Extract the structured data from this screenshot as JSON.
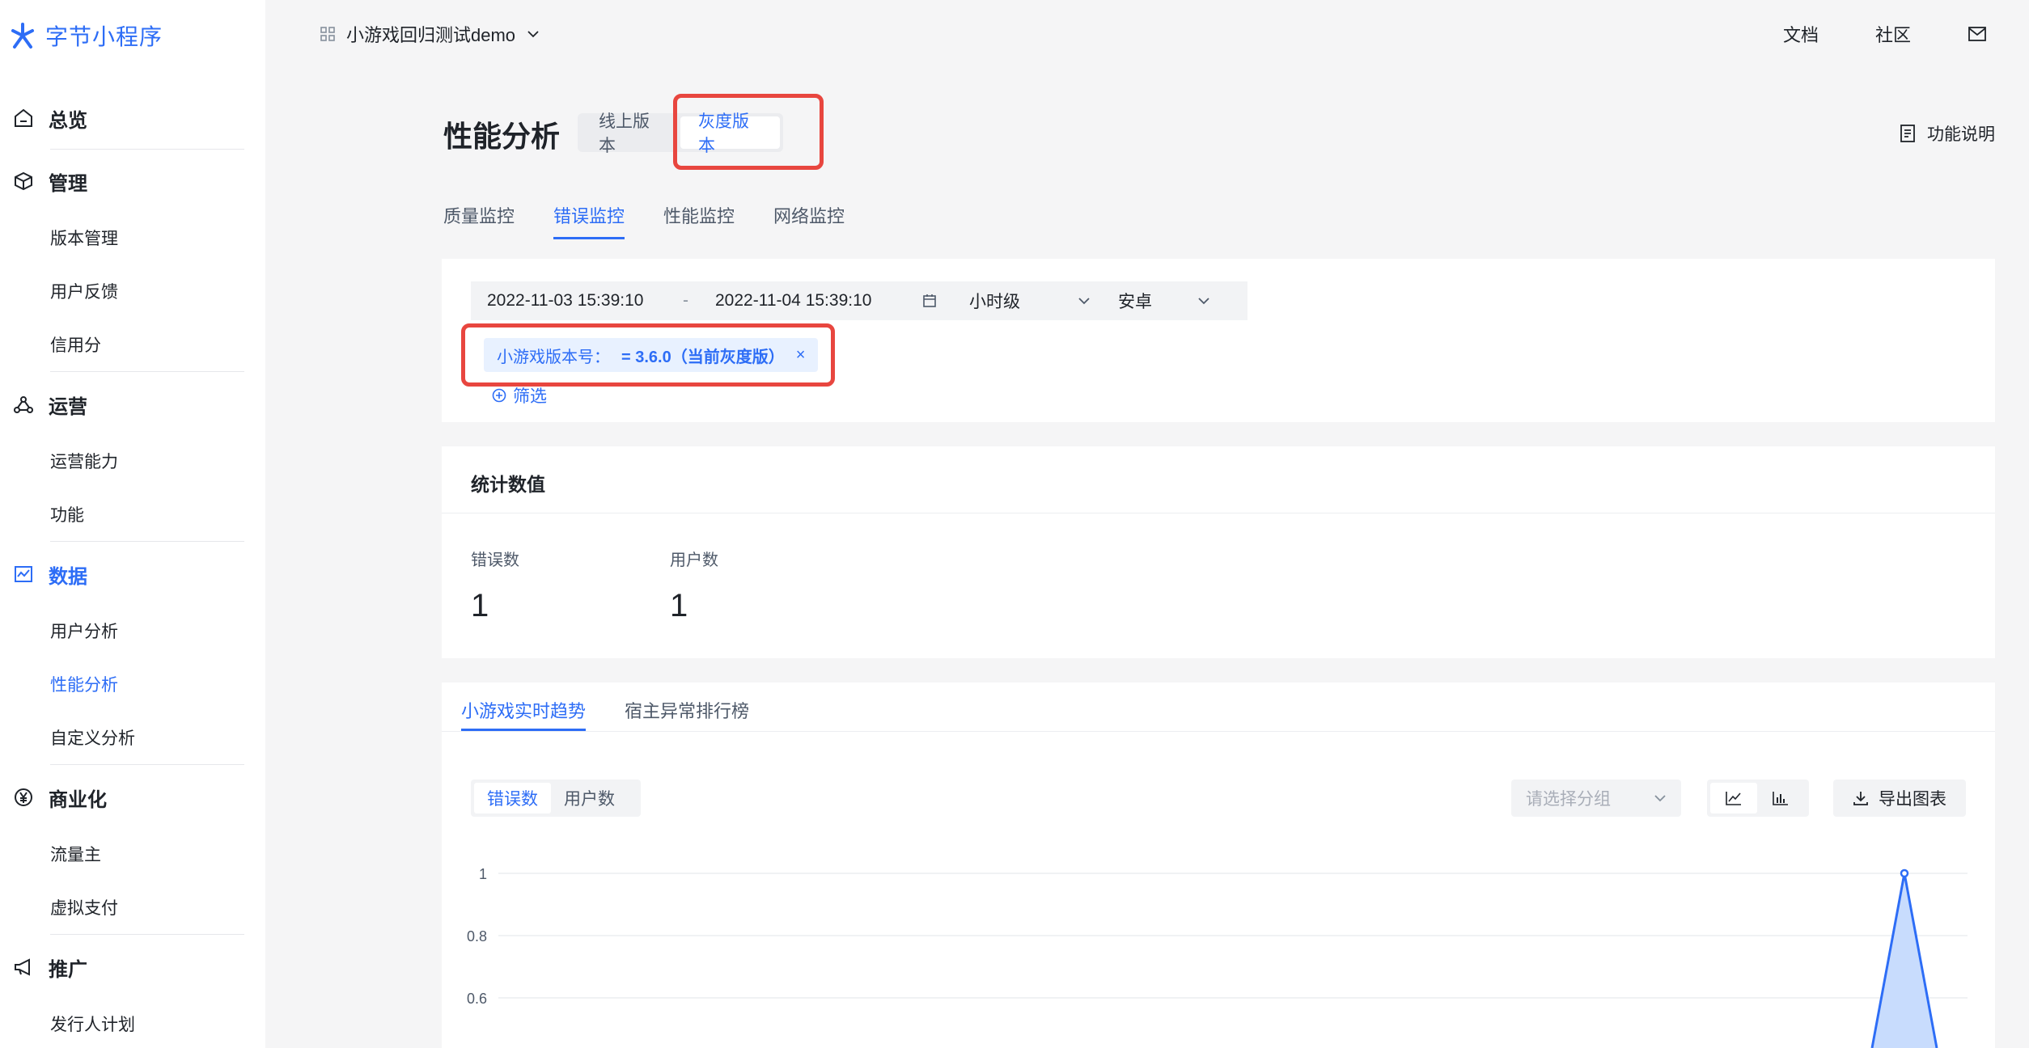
{
  "brand": {
    "name": "字节小程序",
    "color": "#2d6df6"
  },
  "sidebar": {
    "groups": [
      {
        "label": "总览",
        "icon": "home-icon",
        "items": []
      },
      {
        "label": "管理",
        "icon": "cube-icon",
        "items": [
          "版本管理",
          "用户反馈",
          "信用分"
        ]
      },
      {
        "label": "运营",
        "icon": "operation-icon",
        "items": [
          "运营能力",
          "功能"
        ]
      },
      {
        "label": "数据",
        "icon": "chart-line-icon",
        "items": [
          "用户分析",
          "性能分析",
          "自定义分析"
        ],
        "active": true,
        "active_item": "性能分析"
      },
      {
        "label": "商业化",
        "icon": "yen-icon",
        "items": [
          "流量主",
          "虚拟支付"
        ]
      },
      {
        "label": "推广",
        "icon": "megaphone-icon",
        "items": [
          "发行人计划"
        ]
      }
    ]
  },
  "topbar": {
    "app_name": "小游戏回归测试demo",
    "links": [
      "文档",
      "社区"
    ]
  },
  "header": {
    "title": "性能分析",
    "version_tabs": [
      "线上版本",
      "灰度版本"
    ],
    "active_version": "灰度版本",
    "help_label": "功能说明"
  },
  "main_tabs": {
    "items": [
      "质量监控",
      "错误监控",
      "性能监控",
      "网络监控"
    ],
    "active": "错误监控"
  },
  "filters": {
    "date_start": "2022-11-03 15:39:10",
    "date_separator": "-",
    "date_end": "2022-11-04 15:39:10",
    "granularity": "小时级",
    "platform": "安卓",
    "tag_key": "小游戏版本号：",
    "tag_value": "= 3.6.0（当前灰度版）",
    "tag_close": "×",
    "add_filter_label": "筛选"
  },
  "stats": {
    "title": "统计数值",
    "items": [
      {
        "label": "错误数",
        "value": "1"
      },
      {
        "label": "用户数",
        "value": "1"
      }
    ]
  },
  "trend": {
    "tabs": [
      "小游戏实时趋势",
      "宿主异常排行榜"
    ],
    "active_tab": "小游戏实时趋势",
    "metrics": [
      "错误数",
      "用户数"
    ],
    "active_metric": "错误数",
    "group_placeholder": "请选择分组",
    "export_label": "导出图表"
  },
  "chart_data": {
    "type": "area",
    "y_ticks": [
      "1",
      "0.8",
      "0.6"
    ],
    "ylim": [
      0,
      1
    ],
    "series": [
      {
        "values": [
          0,
          1,
          0
        ]
      }
    ],
    "line_color": "#2d6df6",
    "fill_color": "#c8dcfd"
  },
  "colors": {
    "accent": "#2d6df6",
    "highlight": "#e8463f"
  }
}
